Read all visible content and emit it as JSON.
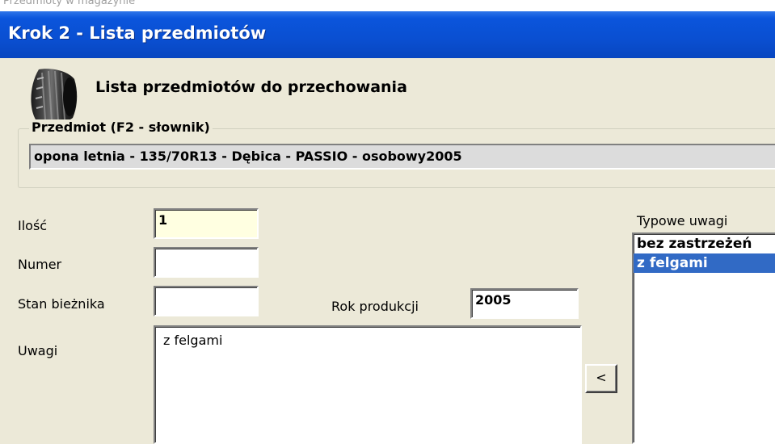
{
  "window": {
    "title": "Krok 2 - Lista przedmiotów",
    "background_title_fragment": "Przedmioty w magazynie"
  },
  "header": {
    "icon": "tire-icon",
    "heading": "Lista przedmiotów do przechowania"
  },
  "item_group": {
    "legend": "Przedmiot (F2 - słownik)",
    "value": "opona letnia - 135/70R13 - Dębica - PASSIO - osobowy2005"
  },
  "form": {
    "quantity_label": "Ilość",
    "quantity_value": "1",
    "number_label": "Numer",
    "number_value": "",
    "tread_label": "Stan bieżnika",
    "tread_value": "",
    "year_label": "Rok produkcji",
    "year_value": "2005",
    "notes_label": "Uwagi",
    "notes_value": "z felgami"
  },
  "add_note_button": "<",
  "typical_notes": {
    "label": "Typowe uwagi",
    "items": [
      "bez zastrzeżeń",
      "z felgami"
    ],
    "selected_index": 1
  },
  "colors": {
    "titlebar": "#0a4fd1",
    "selection": "#316ac5",
    "window_bg": "#ece9d8",
    "quantity_bg": "#ffffe1"
  }
}
